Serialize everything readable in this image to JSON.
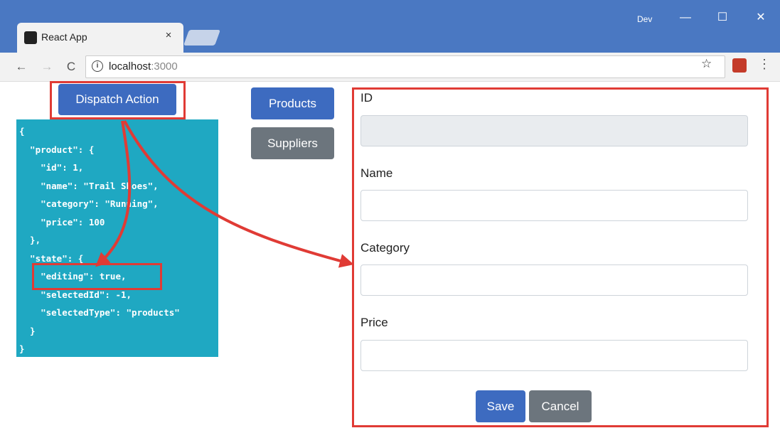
{
  "window": {
    "user": "Dev",
    "minimize": "—",
    "maximize": "☐",
    "close": "✕"
  },
  "tab": {
    "title": "React App",
    "close": "×"
  },
  "toolbar": {
    "back": "←",
    "forward": "→",
    "reload": "C",
    "url_host": "localhost",
    "url_port": ":3000",
    "info": "i",
    "star": "☆",
    "menu": "⋮"
  },
  "page": {
    "dispatch_label": "Dispatch Action",
    "json_text": "{\n  \"product\": {\n    \"id\": 1,\n    \"name\": \"Trail Shoes\",\n    \"category\": \"Running\",\n    \"price\": 100\n  },\n  \"state\": {\n    \"editing\": true,\n    \"selectedId\": -1,\n    \"selectedType\": \"products\"\n  }\n}",
    "nav": {
      "products": "Products",
      "suppliers": "Suppliers"
    },
    "form": {
      "id_label": "ID",
      "id_value": "",
      "name_label": "Name",
      "name_value": "",
      "category_label": "Category",
      "category_value": "",
      "price_label": "Price",
      "price_value": "",
      "save": "Save",
      "cancel": "Cancel"
    }
  },
  "colors": {
    "accent": "#3d6bc0",
    "secondary": "#6c757d",
    "json_bg": "#1fa8c2",
    "highlight": "#e03b35",
    "titlebar": "#4a78c2"
  }
}
